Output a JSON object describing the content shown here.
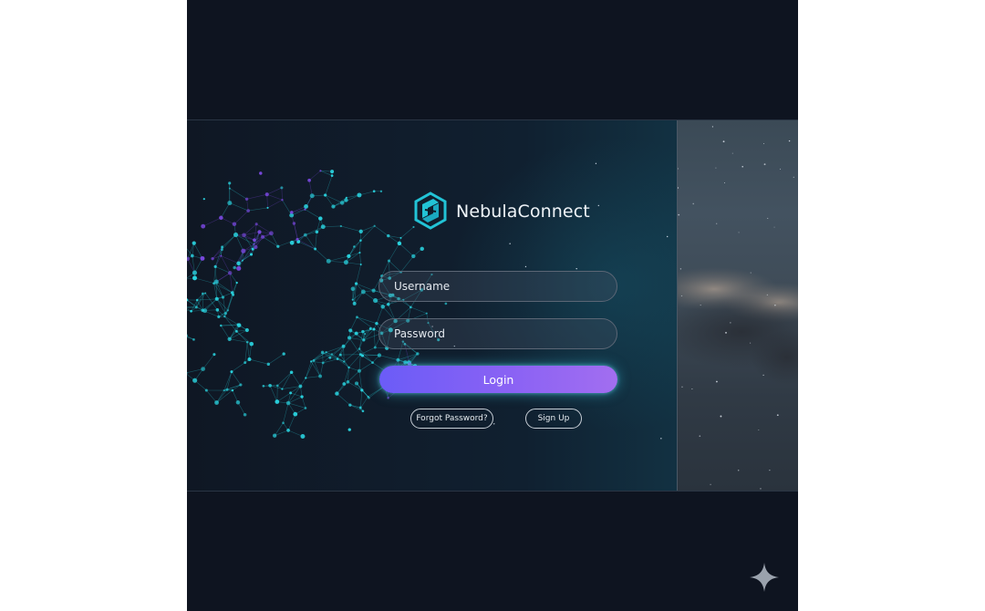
{
  "brand": {
    "name": "NebulaConnect",
    "logo_icon": "hexagon-knot-icon",
    "accent": "#22c3d6"
  },
  "login_form": {
    "username_placeholder": "Username",
    "password_placeholder": "Password",
    "login_label": "Login",
    "forgot_label": "Forgot Password?",
    "signup_label": "Sign Up"
  },
  "colors": {
    "background": "#0e1420",
    "login_gradient_start": "#6b5cf7",
    "login_gradient_end": "#a26ef0",
    "network_cyan": "#2ad4e0",
    "network_purple": "#7a48e0"
  },
  "decor": {
    "corner_icon": "sparkle-icon",
    "side_image": "nebula-cloud-image"
  }
}
